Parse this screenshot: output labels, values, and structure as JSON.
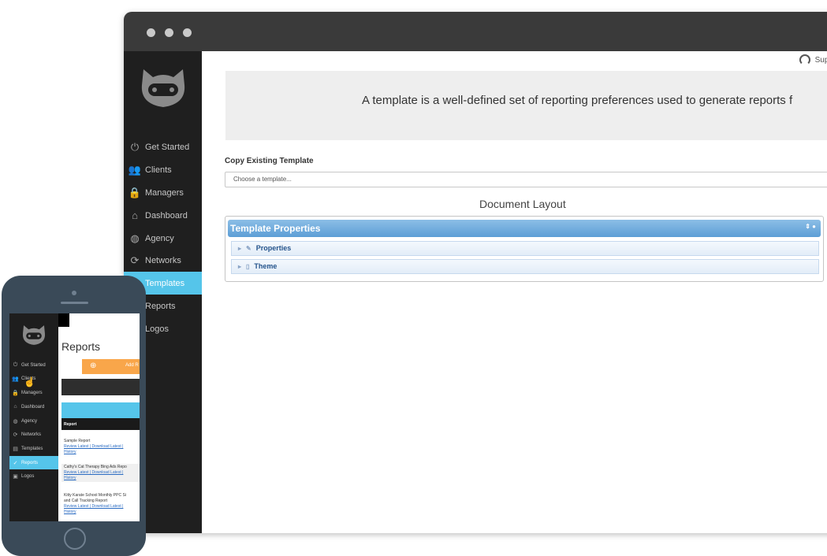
{
  "desktop": {
    "support_label": "Supp",
    "banner_text": "A template is a well-defined set of reporting preferences used to generate reports f",
    "copy_label": "Copy Existing Template",
    "copy_placeholder": "Choose a template...",
    "document_layout": "Document Layout",
    "panel": {
      "title": "Template Properties",
      "rows": [
        {
          "label": "Properties",
          "icon": "wrench-icon"
        },
        {
          "label": "Theme",
          "icon": "document-icon"
        }
      ]
    },
    "nav": [
      {
        "label": "Get Started",
        "icon": "power-icon"
      },
      {
        "label": "Clients",
        "icon": "users-icon"
      },
      {
        "label": "Managers",
        "icon": "lock-icon"
      },
      {
        "label": "Dashboard",
        "icon": "home-icon"
      },
      {
        "label": "Agency",
        "icon": "globe-icon"
      },
      {
        "label": "Networks",
        "icon": "refresh-icon"
      },
      {
        "label": "Templates",
        "icon": "template-icon",
        "active": true
      },
      {
        "label": "Reports",
        "icon": "check-icon"
      },
      {
        "label": "Logos",
        "icon": "image-icon"
      }
    ]
  },
  "phone": {
    "title": "Reports",
    "add_label": "Add R",
    "table_header": "Report",
    "nav": [
      {
        "label": "Get Started",
        "icon": "power-icon"
      },
      {
        "label": "Clients",
        "icon": "users-icon"
      },
      {
        "label": "Managers",
        "icon": "lock-icon"
      },
      {
        "label": "Dashboard",
        "icon": "home-icon"
      },
      {
        "label": "Agency",
        "icon": "globe-icon"
      },
      {
        "label": "Networks",
        "icon": "refresh-icon"
      },
      {
        "label": "Templates",
        "icon": "template-icon"
      },
      {
        "label": "Reports",
        "icon": "check-icon",
        "active": true
      },
      {
        "label": "Logos",
        "icon": "image-icon"
      }
    ],
    "reports": [
      {
        "name": "Sample Report",
        "links": "Review Latest | Download Latest |",
        "history": "History"
      },
      {
        "name": "Cathy's Cat Therapy Bing Ads Repo",
        "links": "Review Latest | Download Latest |",
        "history": "History"
      },
      {
        "name": "Kitty Karate School Monthly PPC Si",
        "name2": "and Call Tracking Report",
        "links": "Review Latest | Download Latest |",
        "history": "History"
      }
    ]
  },
  "colors": {
    "accent": "#55c5ea",
    "sidebar": "#1f1f1f",
    "panel_head": "#5c9ed6",
    "add_button": "#f9a64a",
    "titlebar": "#3a3a3a",
    "phone_body": "#3a4a58"
  }
}
